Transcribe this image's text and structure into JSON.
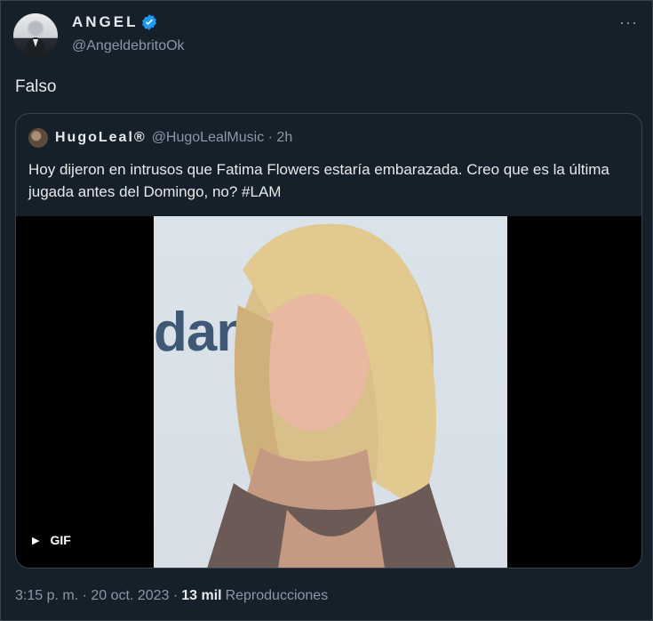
{
  "author": {
    "display_name": "ANGEL",
    "handle": "@AngeldebritoOk",
    "verified": true
  },
  "more_icon": "ellipsis-icon",
  "tweet_text": "Falso",
  "quoted": {
    "display_name": "HugoLeal®",
    "handle_time": "@HugoLealMusic · 2h",
    "text": "Hoy dijeron en intrusos que Fatima Flowers estaría embarazada. Creo que es la última jugada antes del Domingo, no? #LAM",
    "media": {
      "type": "gif",
      "badge": "GIF",
      "background_text": "dan"
    }
  },
  "meta": {
    "timestamp": "3:15 p. m. · 20 oct. 2023 ·",
    "views_count": "13 mil",
    "views_label": "Reproducciones"
  },
  "colors": {
    "background": "#15202b",
    "border": "#38444d",
    "secondary_text": "#8b98a5",
    "verified_blue": "#1d9bf0"
  }
}
